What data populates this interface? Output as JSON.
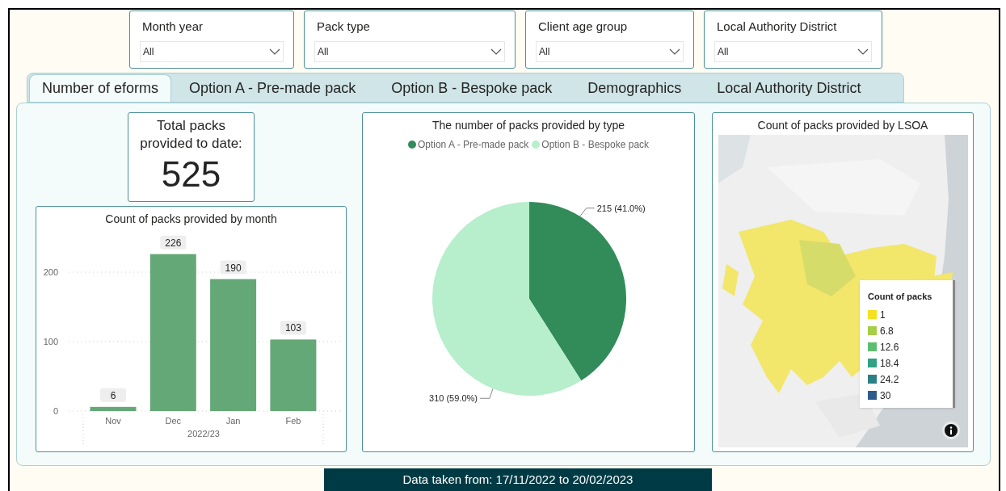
{
  "filters": [
    {
      "label": "Month year",
      "value": "All"
    },
    {
      "label": "Pack type",
      "value": "All"
    },
    {
      "label": "Client age group",
      "value": "All"
    },
    {
      "label": "Local Authority District",
      "value": "All"
    }
  ],
  "tabs": [
    {
      "label": "Number of eforms",
      "selected": true
    },
    {
      "label": "Option A - Pre-made pack",
      "selected": false
    },
    {
      "label": "Option B - Bespoke pack",
      "selected": false
    },
    {
      "label": "Demographics",
      "selected": false
    },
    {
      "label": "Local Authority District",
      "selected": false
    }
  ],
  "total_card": {
    "title": "Total packs provided to date:",
    "value": "525"
  },
  "bar_card": {
    "title": "Count of packs provided by month",
    "chart_data": {
      "type": "bar",
      "categories": [
        "Nov",
        "Dec",
        "Jan",
        "Feb"
      ],
      "xlabel": "2022/23",
      "series": [
        {
          "color": "#65a877",
          "values": [
            6,
            226,
            190,
            103
          ]
        }
      ],
      "ylim": [
        0,
        250
      ],
      "yticks": [
        0,
        100,
        200
      ],
      "data_labels": true
    }
  },
  "pie_card": {
    "title": "The number of packs provided by type",
    "chart_data": {
      "type": "pie",
      "categories": [
        "Option A - Pre-made pack",
        "Option B - Bespoke pack"
      ],
      "series": [
        {
          "values": [
            41.0,
            59.0
          ]
        }
      ],
      "colors": [
        "#318c5a",
        "#b7eecb"
      ],
      "value_labels": [
        "215 (41.0%)",
        "310 (59.0%)"
      ]
    }
  },
  "map_card": {
    "title": "Count of packs provided by LSOA",
    "legend": {
      "title": "Count of packs",
      "items": [
        {
          "label": "1",
          "color": "#f5e11e"
        },
        {
          "label": "6.8",
          "color": "#a4cf46"
        },
        {
          "label": "12.6",
          "color": "#5cbf6f"
        },
        {
          "label": "18.4",
          "color": "#2fa184"
        },
        {
          "label": "24.2",
          "color": "#2b7f86"
        },
        {
          "label": "30",
          "color": "#2f5b8c"
        }
      ]
    }
  },
  "footer": "Data taken from: 17/11/2022 to 20/02/2023"
}
